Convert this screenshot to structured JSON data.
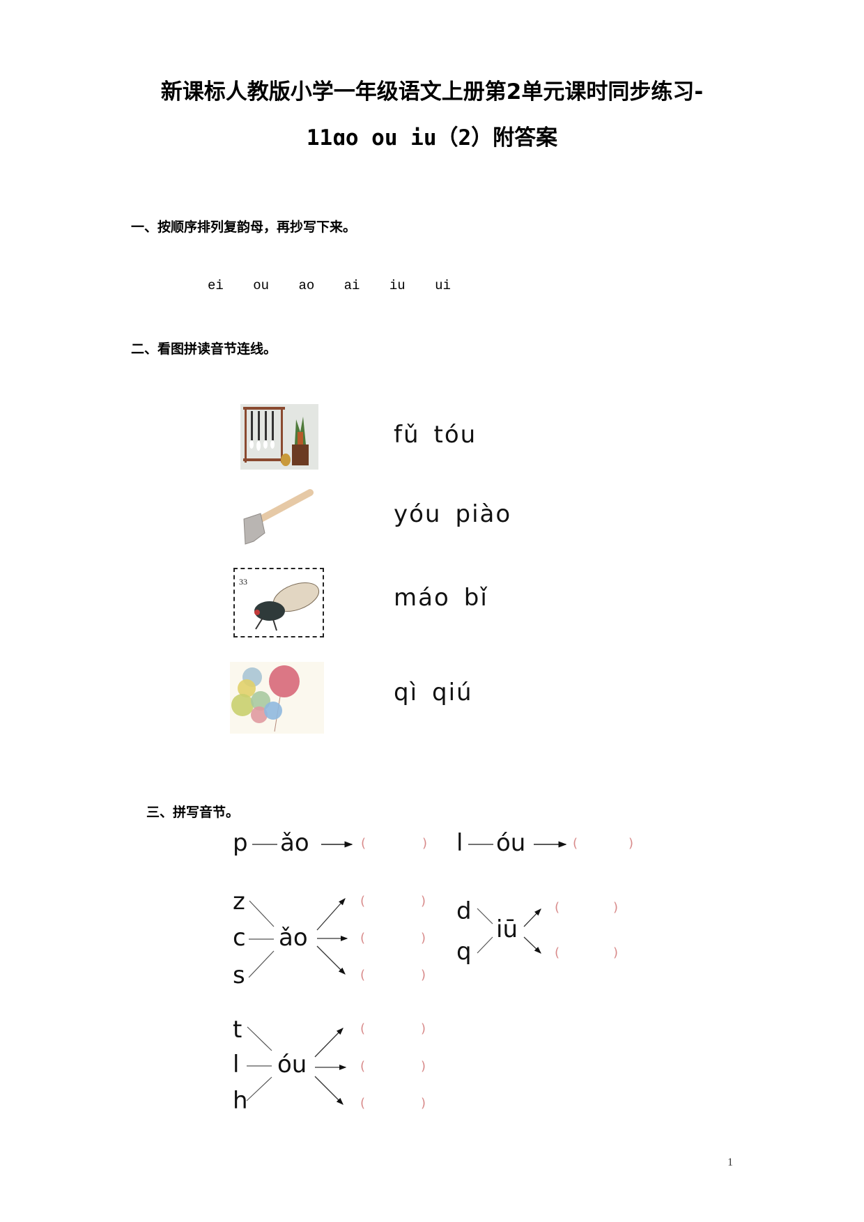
{
  "document": {
    "title_line1": "新课标人教版小学一年级语文上册第2单元课时同步练习-",
    "title_line2": "11ɑo ou iu（2）附答案",
    "page_number": "1"
  },
  "section1": {
    "heading": "一、按顺序排列复韵母，再抄写下来。",
    "finals": [
      "ei",
      "ou",
      "ao",
      "ai",
      "iu",
      "ui"
    ]
  },
  "section2": {
    "heading": "二、看图拼读音节连线。",
    "pictures": [
      {
        "name": "brush-rack-picture",
        "description": "毛笔"
      },
      {
        "name": "axe-picture",
        "description": "斧头"
      },
      {
        "name": "stamp-picture",
        "description": "邮票"
      },
      {
        "name": "balloons-picture",
        "description": "气球"
      }
    ],
    "syllables": [
      {
        "a": "fǔ",
        "b": "tóu"
      },
      {
        "a": "yóu",
        "b": "piào"
      },
      {
        "a": "máo",
        "b": "bǐ"
      },
      {
        "a": "qì",
        "b": "qiú"
      }
    ]
  },
  "section3": {
    "heading": "三、拼写音节。",
    "bracket_open": "(",
    "bracket_close": ")",
    "drills": [
      {
        "initials": [
          "p"
        ],
        "final": "ǎo"
      },
      {
        "initials": [
          "l"
        ],
        "final": "óu"
      },
      {
        "initials": [
          "z",
          "c",
          "s"
        ],
        "final": "ǎo"
      },
      {
        "initials": [
          "d",
          "q"
        ],
        "final": "iū"
      },
      {
        "initials": [
          "t",
          "l",
          "h"
        ],
        "final": "óu"
      }
    ],
    "bracket_color": "#d88a8a"
  }
}
